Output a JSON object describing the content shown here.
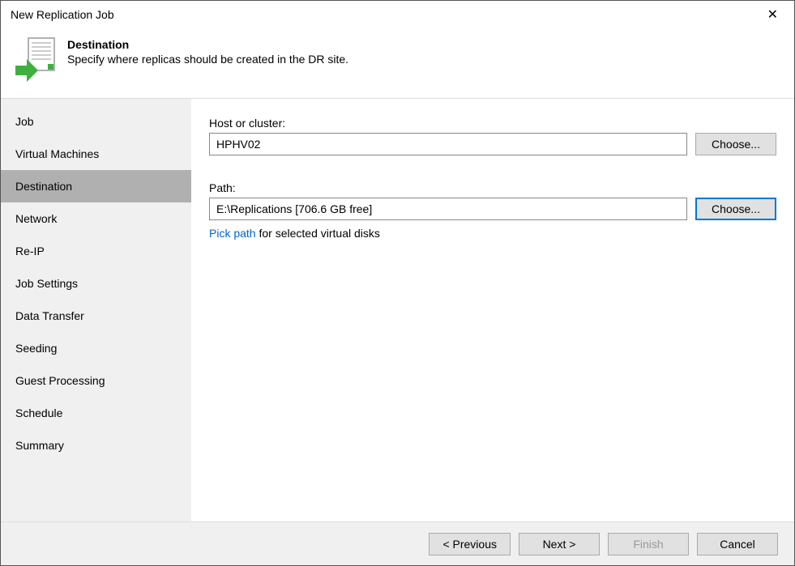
{
  "window": {
    "title": "New Replication Job"
  },
  "header": {
    "title": "Destination",
    "subtitle": "Specify where replicas should be created in the DR site."
  },
  "sidebar": {
    "items": [
      {
        "label": "Job"
      },
      {
        "label": "Virtual Machines"
      },
      {
        "label": "Destination"
      },
      {
        "label": "Network"
      },
      {
        "label": "Re-IP"
      },
      {
        "label": "Job Settings"
      },
      {
        "label": "Data Transfer"
      },
      {
        "label": "Seeding"
      },
      {
        "label": "Guest Processing"
      },
      {
        "label": "Schedule"
      },
      {
        "label": "Summary"
      }
    ],
    "active_index": 2
  },
  "content": {
    "host_label": "Host or cluster:",
    "host_value": "HPHV02",
    "host_choose": "Choose...",
    "path_label": "Path:",
    "path_value": "E:\\Replications [706.6 GB free]",
    "path_choose": "Choose...",
    "pick_link": "Pick path",
    "pick_text": " for selected virtual disks"
  },
  "footer": {
    "previous": "< Previous",
    "next": "Next >",
    "finish": "Finish",
    "cancel": "Cancel"
  }
}
